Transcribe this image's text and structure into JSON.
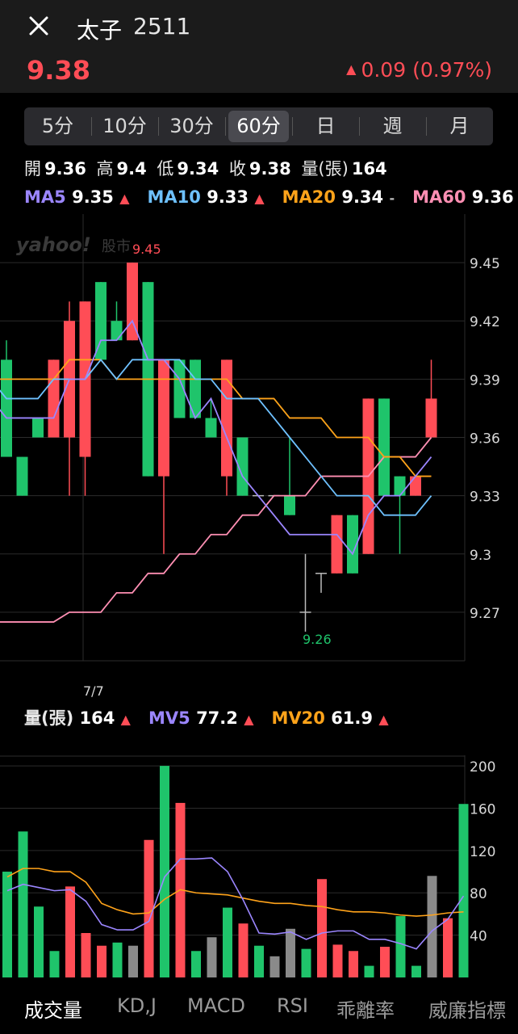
{
  "header": {
    "close_icon": "close-icon",
    "name": "太子",
    "code": "2511",
    "price": "9.38",
    "change_arrow": "▲",
    "change": "0.09 (0.97%)",
    "up_color": "#ff4d56",
    "down_color": "#1fc46b"
  },
  "period_tabs": [
    "5分",
    "10分",
    "30分",
    "60分",
    "日",
    "週",
    "月"
  ],
  "selected_period": "60分",
  "ohlc": {
    "open_label": "開",
    "open": "9.36",
    "high_label": "高",
    "high": "9.4",
    "low_label": "低",
    "low": "9.34",
    "close_label": "收",
    "close": "9.38",
    "vol_label": "量(張)",
    "vol": "164"
  },
  "ma_legend": [
    {
      "label": "MA5",
      "value": "9.35",
      "trend": "▲",
      "color": "#9b86ff"
    },
    {
      "label": "MA10",
      "value": "9.33",
      "trend": "▲",
      "color": "#6ec1ff"
    },
    {
      "label": "MA20",
      "value": "9.34",
      "trend": "-",
      "color": "#ffa31a"
    },
    {
      "label": "MA60",
      "value": "9.36",
      "trend": "▲",
      "color": "#ff8fb3"
    }
  ],
  "watermark": {
    "brand": "yahoo!",
    "suffix": "股市"
  },
  "price_chart": {
    "y_ticks": [
      "9.45",
      "9.42",
      "9.39",
      "9.36",
      "9.33",
      "9.3",
      "9.27"
    ],
    "high_label": "9.45",
    "low_label": "9.26",
    "date_label": "7/7"
  },
  "volume_legend": [
    {
      "label": "量(張)",
      "value": "164",
      "trend": "▲",
      "color": "#e8e8e8"
    },
    {
      "label": "MV5",
      "value": "77.2",
      "trend": "▲",
      "color": "#9b86ff"
    },
    {
      "label": "MV20",
      "value": "61.9",
      "trend": "▲",
      "color": "#ffa31a"
    }
  ],
  "volume_chart": {
    "y_ticks": [
      "200",
      "160",
      "120",
      "80",
      "40"
    ]
  },
  "chart_data": {
    "type": "candlestick",
    "price_ylim": [
      9.245,
      9.475
    ],
    "candles": [
      {
        "o": 9.4,
        "c": 9.35,
        "h": 9.41,
        "l": 9.35
      },
      {
        "o": 9.35,
        "c": 9.33,
        "h": 9.35,
        "l": 9.33
      },
      {
        "o": 9.37,
        "c": 9.36,
        "h": 9.37,
        "l": 9.36
      },
      {
        "o": 9.36,
        "c": 9.4,
        "h": 9.4,
        "l": 9.36
      },
      {
        "o": 9.36,
        "c": 9.42,
        "h": 9.43,
        "l": 9.33
      },
      {
        "o": 9.35,
        "c": 9.43,
        "h": 9.43,
        "l": 9.33
      },
      {
        "o": 9.44,
        "c": 9.4,
        "h": 9.44,
        "l": 9.4
      },
      {
        "o": 9.42,
        "c": 9.41,
        "h": 9.43,
        "l": 9.41
      },
      {
        "o": 9.41,
        "c": 9.45,
        "h": 9.45,
        "l": 9.41
      },
      {
        "o": 9.44,
        "c": 9.34,
        "h": 9.44,
        "l": 9.34
      },
      {
        "o": 9.34,
        "c": 9.4,
        "h": 9.4,
        "l": 9.3
      },
      {
        "o": 9.4,
        "c": 9.37,
        "h": 9.4,
        "l": 9.37
      },
      {
        "o": 9.4,
        "c": 9.37,
        "h": 9.4,
        "l": 9.37
      },
      {
        "o": 9.37,
        "c": 9.36,
        "h": 9.38,
        "l": 9.36
      },
      {
        "o": 9.34,
        "c": 9.4,
        "h": 9.4,
        "l": 9.33
      },
      {
        "o": 9.36,
        "c": 9.33,
        "h": 9.36,
        "l": 9.33
      },
      {
        "o": 9.33,
        "c": 9.33,
        "h": 9.33,
        "l": 9.33
      },
      {
        "o": 9.33,
        "c": 9.33,
        "h": 9.33,
        "l": 9.33
      },
      {
        "o": 9.33,
        "c": 9.32,
        "h": 9.36,
        "l": 9.32
      },
      {
        "o": 9.27,
        "c": 9.27,
        "h": 9.3,
        "l": 9.26
      },
      {
        "o": 9.29,
        "c": 9.29,
        "h": 9.29,
        "l": 9.28
      },
      {
        "o": 9.29,
        "c": 9.32,
        "h": 9.32,
        "l": 9.29
      },
      {
        "o": 9.32,
        "c": 9.29,
        "h": 9.32,
        "l": 9.29
      },
      {
        "o": 9.3,
        "c": 9.38,
        "h": 9.38,
        "l": 9.3
      },
      {
        "o": 9.38,
        "c": 9.33,
        "h": 9.38,
        "l": 9.33
      },
      {
        "o": 9.34,
        "c": 9.33,
        "h": 9.34,
        "l": 9.3
      },
      {
        "o": 9.33,
        "c": 9.34,
        "h": 9.34,
        "l": 9.33
      },
      {
        "o": 9.36,
        "c": 9.38,
        "h": 9.4,
        "l": 9.36
      }
    ],
    "ma5": [
      9.38,
      9.37,
      9.37,
      9.37,
      9.37,
      9.39,
      9.39,
      9.41,
      9.41,
      9.42,
      9.4,
      9.4,
      9.39,
      9.37,
      9.38,
      9.36,
      9.34,
      9.33,
      9.32,
      9.31,
      9.31,
      9.31,
      9.31,
      9.3,
      9.32,
      9.33,
      9.33,
      9.34,
      9.35
    ],
    "ma10": [
      9.39,
      9.38,
      9.38,
      9.38,
      9.39,
      9.39,
      9.39,
      9.4,
      9.39,
      9.4,
      9.4,
      9.4,
      9.4,
      9.39,
      9.39,
      9.38,
      9.38,
      9.38,
      9.37,
      9.36,
      9.35,
      9.34,
      9.33,
      9.33,
      9.33,
      9.32,
      9.32,
      9.32,
      9.33
    ],
    "ma20": [
      9.39,
      9.39,
      9.39,
      9.39,
      9.39,
      9.4,
      9.4,
      9.4,
      9.39,
      9.39,
      9.39,
      9.39,
      9.39,
      9.39,
      9.39,
      9.39,
      9.38,
      9.38,
      9.38,
      9.37,
      9.37,
      9.37,
      9.36,
      9.36,
      9.36,
      9.35,
      9.35,
      9.34,
      9.34
    ],
    "ma60": [
      9.265,
      9.265,
      9.265,
      9.265,
      9.265,
      9.27,
      9.27,
      9.27,
      9.28,
      9.28,
      9.29,
      9.29,
      9.3,
      9.3,
      9.31,
      9.31,
      9.32,
      9.32,
      9.33,
      9.33,
      9.33,
      9.34,
      9.34,
      9.34,
      9.34,
      9.35,
      9.35,
      9.35,
      9.36
    ],
    "volume_ylim": [
      0,
      210
    ],
    "volume": [
      100,
      138,
      67,
      25,
      86,
      42,
      30,
      33,
      30,
      130,
      200,
      165,
      25,
      38,
      66,
      51,
      30,
      20,
      46,
      27,
      93,
      31,
      25,
      11,
      29,
      58,
      11,
      96,
      56,
      164
    ],
    "volume_flat": [
      false,
      false,
      false,
      false,
      false,
      false,
      false,
      false,
      true,
      false,
      false,
      false,
      false,
      true,
      false,
      false,
      false,
      true,
      true,
      false,
      false,
      false,
      false,
      false,
      false,
      false,
      false,
      true,
      false,
      false
    ],
    "mv5": [
      82,
      88,
      85,
      82,
      83,
      72,
      50,
      45,
      45,
      53,
      95,
      112,
      112,
      113,
      100,
      73,
      42,
      41,
      43,
      36,
      42,
      44,
      44,
      36,
      36,
      32,
      27,
      44,
      55,
      77
    ],
    "mv20": [
      95,
      103,
      103,
      100,
      100,
      90,
      70,
      64,
      60,
      61,
      74,
      83,
      80,
      79,
      78,
      75,
      72,
      70,
      70,
      68,
      67,
      64,
      62,
      62,
      61,
      59,
      58,
      59,
      61,
      62
    ]
  },
  "bottom_tabs": [
    "成交量",
    "KD,J",
    "MACD",
    "RSI",
    "乖離率",
    "威廉指標"
  ],
  "selected_bottom_tab": "成交量"
}
